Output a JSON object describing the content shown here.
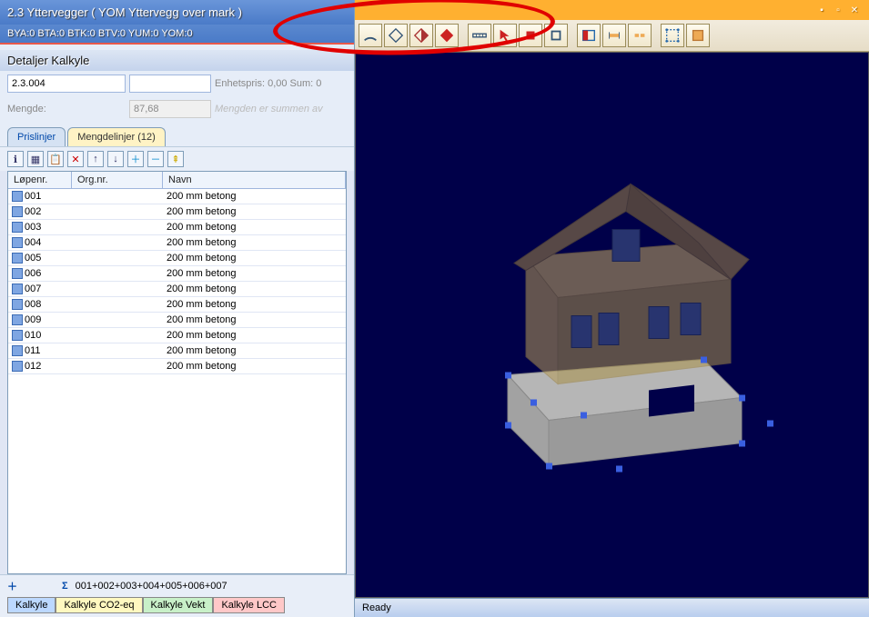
{
  "header": {
    "title": "2.3 Yttervegger  ( YOM Yttervegg over mark )",
    "metrics": "BYA:0 BTA:0 BTK:0 BTV:0 YUM:0 YOM:0"
  },
  "details": {
    "title": "Detaljer Kalkyle",
    "code": "2.3.004",
    "price_label": "Enhetspris: 0,00 Sum: 0",
    "mengde_label": "Mengde:",
    "mengde_value": "87,68",
    "mengde_note": "Mengden er summen av"
  },
  "upper_tabs": {
    "prislinjer": "Prislinjer",
    "mengdelinjer": "Mengdelinjer (12)"
  },
  "grid": {
    "columns": {
      "c1": "Løpenr.",
      "c2": "Org.nr.",
      "c3": "Navn"
    },
    "rows": [
      {
        "nr": "001",
        "navn": "200 mm betong"
      },
      {
        "nr": "002",
        "navn": "200 mm betong"
      },
      {
        "nr": "003",
        "navn": "200 mm betong"
      },
      {
        "nr": "004",
        "navn": "200 mm betong"
      },
      {
        "nr": "005",
        "navn": "200 mm betong"
      },
      {
        "nr": "006",
        "navn": "200 mm betong"
      },
      {
        "nr": "007",
        "navn": "200 mm betong"
      },
      {
        "nr": "008",
        "navn": "200 mm betong"
      },
      {
        "nr": "009",
        "navn": "200 mm betong"
      },
      {
        "nr": "010",
        "navn": "200 mm betong"
      },
      {
        "nr": "011",
        "navn": "200 mm betong"
      },
      {
        "nr": "012",
        "navn": "200 mm betong"
      }
    ],
    "sigma": "Σ",
    "sum_expr": "001+002+003+004+005+006+007"
  },
  "lower_tabs": {
    "t1": "Kalkyle",
    "t2": "Kalkyle CO2-eq",
    "t3": "Kalkyle Vekt",
    "t4": "Kalkyle LCC"
  },
  "right": {
    "title": "",
    "status": "Ready"
  }
}
